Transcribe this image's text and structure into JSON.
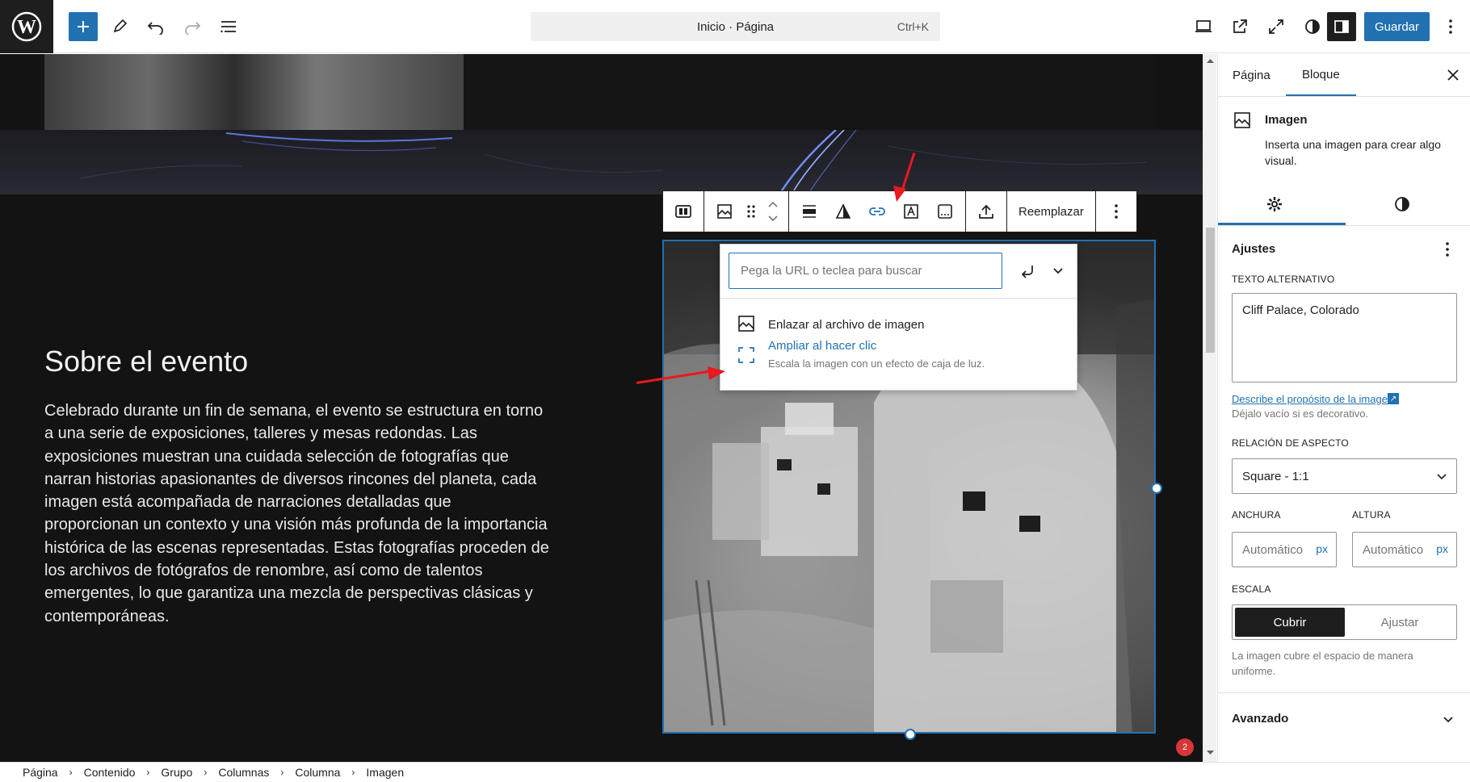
{
  "topbar": {
    "command_bar_text": "Inicio · Página",
    "command_shortcut": "Ctrl+K",
    "save_label": "Guardar"
  },
  "canvas": {
    "section_title": "Sobre el evento",
    "section_body": "Celebrado durante un fin de semana, el evento se estructura en torno a una serie de exposiciones, talleres y mesas redondas. Las exposiciones muestran una cuidada selección de fotografías que narran historias apasionantes de diversos rincones del planeta, cada imagen está acompañada de narraciones detalladas que proporcionan un contexto y una visión más profunda de la importancia histórica de las escenas representadas. Estas fotografías proceden de los archivos de fotógrafos de renombre, así como de talentos emergentes, lo que garantiza una mezcla de perspectivas clásicas y contemporáneas."
  },
  "block_toolbar": {
    "replace_label": "Reemplazar",
    "active_tool": "link-icon"
  },
  "link_popover": {
    "url_placeholder": "Pega la URL o teclea para buscar",
    "option_file_label": "Enlazar al archivo de imagen",
    "option_expand_label": "Ampliar al hacer clic",
    "option_expand_desc": "Escala la imagen con un efecto de caja de luz."
  },
  "sidebar": {
    "tabs": [
      "Página",
      "Bloque"
    ],
    "active_tab": "Bloque",
    "block_name": "Imagen",
    "block_desc": "Inserta una imagen para crear algo visual.",
    "settings_title": "Ajustes",
    "alt_label": "TEXTO ALTERNATIVO",
    "alt_value": "Cliff Palace, Colorado",
    "alt_link": "Describe el propósito de la imagen.",
    "alt_help": "Déjalo vacío si es decorativo.",
    "aspect_label": "RELACIÓN DE ASPECTO",
    "aspect_value": "Square - 1:1",
    "width_label": "ANCHURA",
    "height_label": "ALTURA",
    "width_placeholder": "Automático",
    "height_placeholder": "Automático",
    "unit": "px",
    "scale_label": "ESCALA",
    "scale_options": [
      "Cubrir",
      "Ajustar"
    ],
    "scale_selected": "Cubrir",
    "scale_help": "La imagen cubre el espacio de manera uniforme.",
    "advanced_label": "Avanzado"
  },
  "breadcrumbs": [
    "Página",
    "Contenido",
    "Grupo",
    "Columnas",
    "Columna",
    "Imagen"
  ],
  "notification_count": "2",
  "colors": {
    "accent": "#2271b1",
    "canvas_bg": "#131313",
    "annotation": "#e8191f"
  }
}
